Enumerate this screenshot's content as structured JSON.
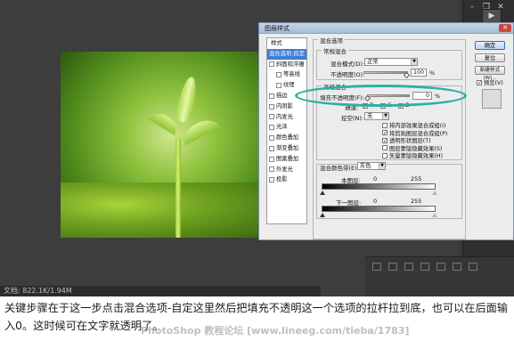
{
  "photoshop": {
    "status_text": "文档: 822.1K/1.94M"
  },
  "dialog": {
    "title": "图层样式",
    "close_label": "✕",
    "styles_list": [
      {
        "label": "样式",
        "type": "header"
      },
      {
        "label": "混合选项:自定",
        "type": "selected"
      },
      {
        "label": "斜面和浮雕",
        "type": "check"
      },
      {
        "label": "等高线",
        "type": "indent"
      },
      {
        "label": "纹理",
        "type": "indent"
      },
      {
        "label": "描边",
        "type": "check"
      },
      {
        "label": "内阴影",
        "type": "check"
      },
      {
        "label": "内发光",
        "type": "check"
      },
      {
        "label": "光泽",
        "type": "check"
      },
      {
        "label": "颜色叠加",
        "type": "check"
      },
      {
        "label": "渐变叠加",
        "type": "check"
      },
      {
        "label": "图案叠加",
        "type": "check"
      },
      {
        "label": "外发光",
        "type": "check"
      },
      {
        "label": "投影",
        "type": "check"
      }
    ],
    "blend_options_title": "混合选项",
    "general_blend_title": "常规混合",
    "blend_mode_label": "混合模式(D):",
    "blend_mode_value": "正常",
    "opacity_label": "不透明度(O):",
    "opacity_value": "100",
    "percent": "%",
    "advanced_blend_title": "高级混合",
    "fill_opacity_label": "填充不透明度(F):",
    "fill_opacity_value": "0",
    "channels_label": "通道:",
    "channels": [
      "R",
      "G",
      "B"
    ],
    "knockout_label": "挖空(N):",
    "knockout_value": "无",
    "options": [
      {
        "label": "将内部效果混合成组(I)",
        "checked": false
      },
      {
        "label": "将剪贴图层混合成组(P)",
        "checked": true
      },
      {
        "label": "透明形状图层(T)",
        "checked": true
      },
      {
        "label": "图层蒙版隐藏效果(S)",
        "checked": false
      },
      {
        "label": "矢量蒙版隐藏效果(H)",
        "checked": false
      }
    ],
    "blend_if_label": "混合颜色带(E):",
    "blend_if_value": "灰色",
    "this_layer_label": "本图层:",
    "this_layer_min": "0",
    "this_layer_max": "255",
    "underlying_label": "下一图层:",
    "underlying_min": "0",
    "underlying_max": "255",
    "buttons": {
      "ok": "确定",
      "reset": "复位",
      "new_style": "新建样式(W)...",
      "preview": "预览(V)"
    }
  },
  "caption": "关键步骤在于这一步点击混合选项-自定这里然后把填充不透明这一个选项的拉杆拉到底，也可以在后面输入0。这时候可在文字就透明了。",
  "watermark": "PhotoShop 教程论坛 [www.lineeg.com/tieba/1783]",
  "colors": {
    "highlight": "#2bb0a4",
    "selection": "#3e7fd0",
    "ps_background": "#3a3a3a"
  }
}
